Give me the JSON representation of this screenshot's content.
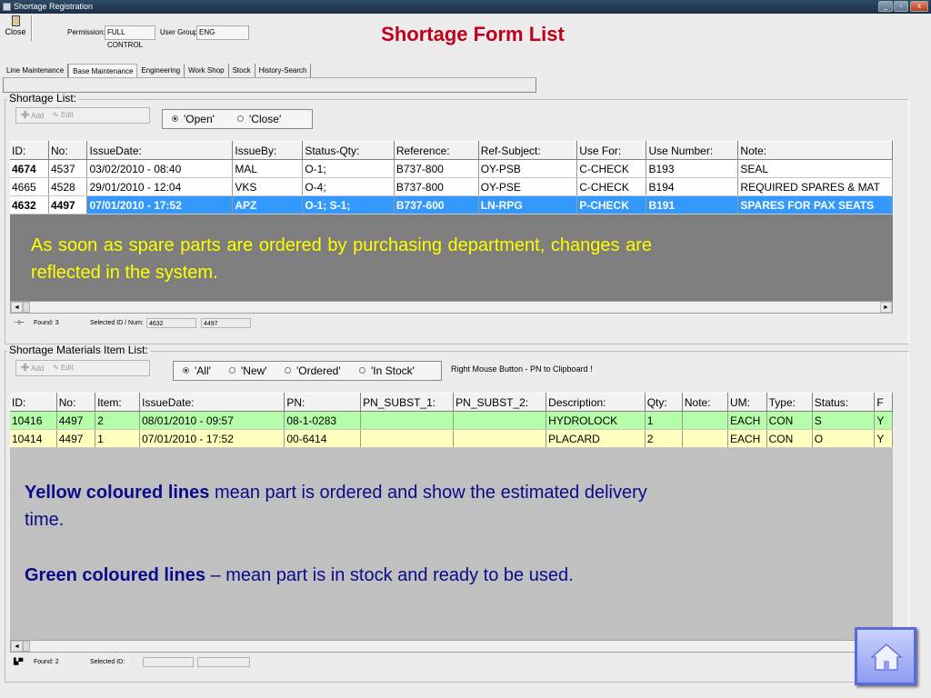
{
  "window": {
    "title": "Shortage Registration",
    "controls": [
      "_",
      "▫",
      "x"
    ]
  },
  "toolbar": {
    "close_label": "Close",
    "permission_label": "Permission:",
    "permission_value": "FULL CONTROL",
    "user_group_label": "User Group:",
    "user_group_value": "ENG"
  },
  "page_title": "Shortage Form List",
  "tabs": [
    "Line Maintenance",
    "Base Maintenance",
    "Engineering",
    "Work Shop",
    "Stock",
    "History-Search"
  ],
  "shortage_list": {
    "group_label": "Shortage List:",
    "add_label": "Add",
    "edit_label": "Edit",
    "filters": [
      "'Open'",
      "'Close'"
    ],
    "selected_filter": "'Open'",
    "columns": [
      "ID:",
      "No:",
      "IssueDate:",
      "IssueBy:",
      "Status-Qty:",
      "Reference:",
      "Ref-Subject:",
      "Use For:",
      "Use Number:",
      "Note:"
    ],
    "rows": [
      [
        "4674",
        "4537",
        "03/02/2010 - 08:40",
        "MAL",
        "O-1;",
        "B737-800",
        "OY-PSB",
        "C-CHECK",
        "B193",
        "SEAL"
      ],
      [
        "4665",
        "4528",
        "29/01/2010 - 12:04",
        "VKS",
        "O-4;",
        "B737-800",
        "OY-PSE",
        "C-CHECK",
        "B194",
        "REQUIRED SPARES & MAT"
      ],
      [
        "4632",
        "4497",
        "07/01/2010 - 17:52",
        "APZ",
        "O-1; S-1;",
        "B737-600",
        "LN-RPG",
        "P-CHECK",
        "B191",
        "SPARES FOR PAX SEATS"
      ]
    ],
    "selected_row": 2,
    "annotation": "As soon as spare parts are ordered by purchasing department, changes are reflected in the system.",
    "status": {
      "found": "Found: 3",
      "selected_label": "Selected ID / Num:",
      "selected_id": "4632",
      "selected_num": "4497"
    }
  },
  "materials_list": {
    "group_label": "Shortage Materials Item List:",
    "add_label": "Add",
    "edit_label": "Edit",
    "filters": [
      "'All'",
      "'New'",
      "'Ordered'",
      "'In Stock'"
    ],
    "selected_filter": "'All'",
    "hint": "Right Mouse Button - PN to Clipboard !",
    "columns": [
      "ID:",
      "No:",
      "Item:",
      "IssueDate:",
      "PN:",
      "PN_SUBST_1:",
      "PN_SUBST_2:",
      "Description:",
      "Qty:",
      "Note:",
      "UM:",
      "Type:",
      "Status:",
      "F"
    ],
    "rows": [
      {
        "color": "green",
        "cells": [
          "10416",
          "4497",
          "2",
          "08/01/2010 - 09:57",
          "08-1-0283",
          "",
          "",
          "HYDROLOCK",
          "1",
          "",
          "EACH",
          "CON",
          "S",
          "Y"
        ]
      },
      {
        "color": "yellow",
        "cells": [
          "10414",
          "4497",
          "1",
          "07/01/2010 - 17:52",
          "00-6414",
          "",
          "",
          "PLACARD",
          "2",
          "",
          "EACH",
          "CON",
          "O",
          "Y"
        ]
      }
    ],
    "annotation": {
      "yellow_bold": "Yellow coloured lines",
      "yellow_rest": " mean part is ordered and show the estimated delivery time.",
      "green_bold": "Green coloured lines",
      "green_rest": " – mean  part is in stock and ready to be used."
    },
    "status": {
      "found": "Found: 2",
      "selected_label": "Selected ID:"
    }
  },
  "colors": {
    "title": "#c00018",
    "selected_row": "#3399ff",
    "green_row": "#b6fdaa",
    "yellow_row": "#ffffbe",
    "note_yellow": "#ffff00",
    "note_blue": "#0a0a8a"
  },
  "icons": [
    "home-icon",
    "door-icon",
    "add-icon",
    "edit-icon"
  ]
}
